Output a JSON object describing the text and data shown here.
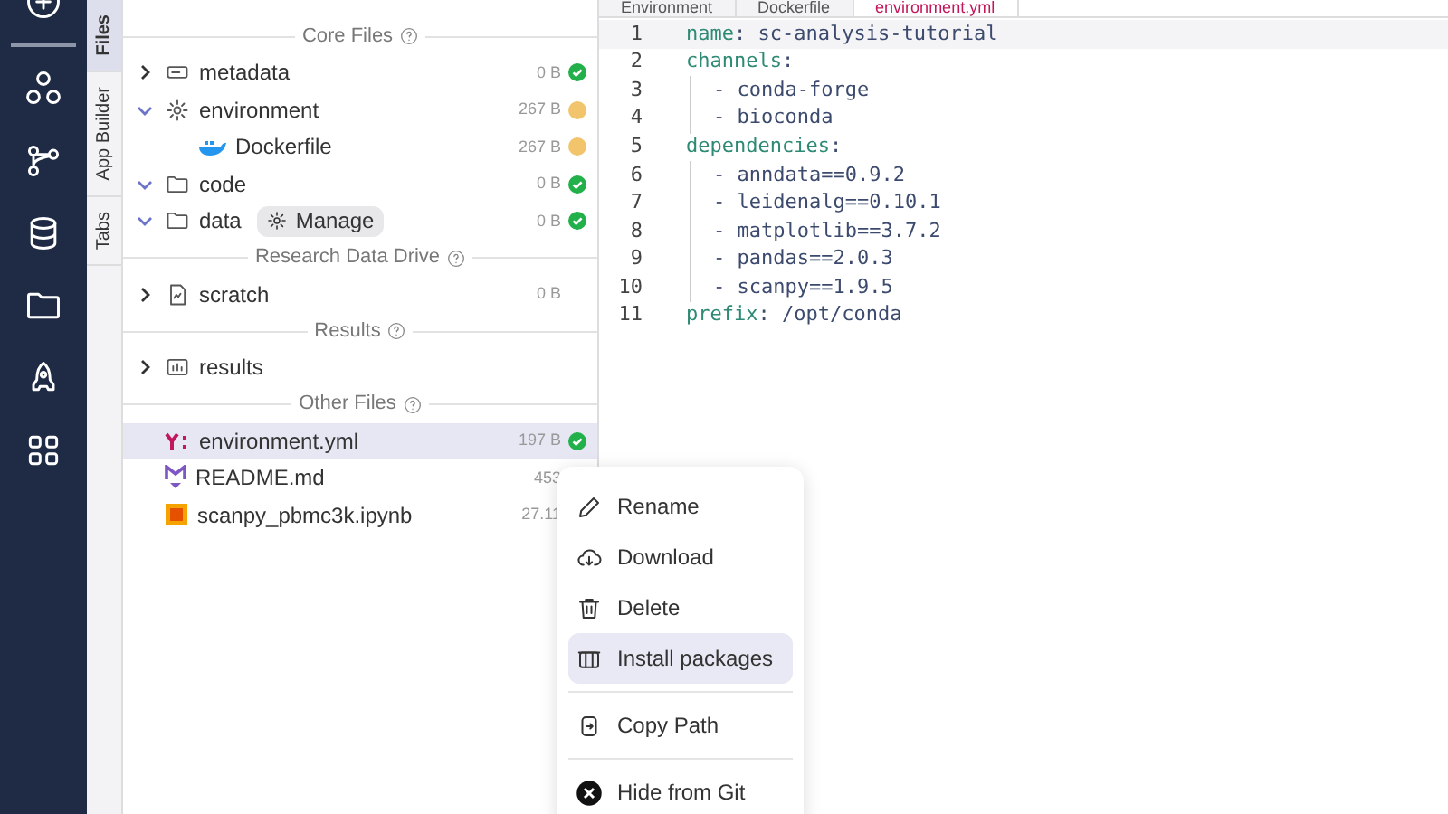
{
  "rail": {
    "items": [
      {
        "kind": "plus"
      },
      {
        "kind": "nodes"
      },
      {
        "kind": "branch"
      },
      {
        "kind": "database"
      },
      {
        "kind": "folder"
      },
      {
        "kind": "rocket"
      },
      {
        "kind": "grid"
      }
    ]
  },
  "side_tabs": [
    {
      "label": "Files",
      "selected": true
    },
    {
      "label": "App Builder",
      "selected": false
    },
    {
      "label": "Tabs",
      "selected": false
    }
  ],
  "sections": [
    {
      "heading": "Core Files",
      "items": [
        {
          "name": "metadata",
          "kind": "tag",
          "size": "0 B",
          "color": "#22b04b",
          "expanded": false
        },
        {
          "name": "environment",
          "kind": "gear",
          "size": "267 B",
          "color": "#f2c46b",
          "expanded": true,
          "children": [
            {
              "name": "Dockerfile",
              "kind": "docker",
              "size": "267 B",
              "color": "#f2c46b"
            }
          ]
        },
        {
          "name": "code",
          "kind": "folder",
          "size": "0 B",
          "color": "#22b04b",
          "expanded": true
        },
        {
          "name": "data",
          "kind": "folder",
          "size": "0 B",
          "color": "#22b04b",
          "expanded": true,
          "badge": "Manage"
        }
      ]
    },
    {
      "heading": "Research Data Drive",
      "items": [
        {
          "name": "scratch",
          "kind": "drive",
          "size": "0 B",
          "expanded": false
        }
      ]
    },
    {
      "heading": "Results",
      "items": [
        {
          "name": "results",
          "kind": "chart",
          "expanded": false
        }
      ]
    },
    {
      "heading": "Other Files",
      "items": [
        {
          "name": "environment.yml",
          "kind": "yaml",
          "size": "197 B",
          "color": "#22b04b",
          "selected": true
        },
        {
          "name": "README.md",
          "kind": "markdown",
          "size": "453",
          "selected": false
        },
        {
          "name": "scanpy_pbmc3k.ipynb",
          "kind": "notebook",
          "size": "27.11",
          "selected": false
        }
      ]
    }
  ],
  "editor_tabs": [
    {
      "label": "Environment",
      "selected": false
    },
    {
      "label": "Dockerfile",
      "selected": false
    },
    {
      "label": "environment.yml",
      "selected": true
    }
  ],
  "code": [
    {
      "number": "1",
      "key": "name",
      "text": ": sc-analysis-tutorial",
      "indent": false
    },
    {
      "number": "2",
      "key": "channels",
      "text": ":",
      "indent": false
    },
    {
      "number": "3",
      "text": "- conda-forge",
      "indent": true
    },
    {
      "number": "4",
      "text": "- bioconda",
      "indent": true
    },
    {
      "number": "5",
      "key": "dependencies",
      "text": ":",
      "indent": false
    },
    {
      "number": "6",
      "text": "- anndata==0.9.2",
      "indent": true
    },
    {
      "number": "7",
      "text": "- leidenalg==0.10.1",
      "indent": true
    },
    {
      "number": "8",
      "text": "- matplotlib==3.7.2",
      "indent": true
    },
    {
      "number": "9",
      "text": "- pandas==2.0.3",
      "indent": true
    },
    {
      "number": "10",
      "text": "- scanpy==1.9.5",
      "indent": true
    },
    {
      "number": "11",
      "key": "prefix",
      "text": ": /opt/conda",
      "indent": false
    }
  ],
  "context_menu": [
    {
      "label": "Rename",
      "kind": "pencil",
      "selected": false
    },
    {
      "label": "Download",
      "kind": "cloud",
      "selected": false
    },
    {
      "label": "Delete",
      "kind": "trash",
      "selected": false
    },
    {
      "label": "Install packages",
      "kind": "package",
      "selected": true
    },
    {
      "label": "Copy Path",
      "kind": "copy",
      "selected": false,
      "divider_before": true
    },
    {
      "label": "Hide from Git",
      "kind": "x-circle",
      "selected": false,
      "divider_before": true
    }
  ]
}
